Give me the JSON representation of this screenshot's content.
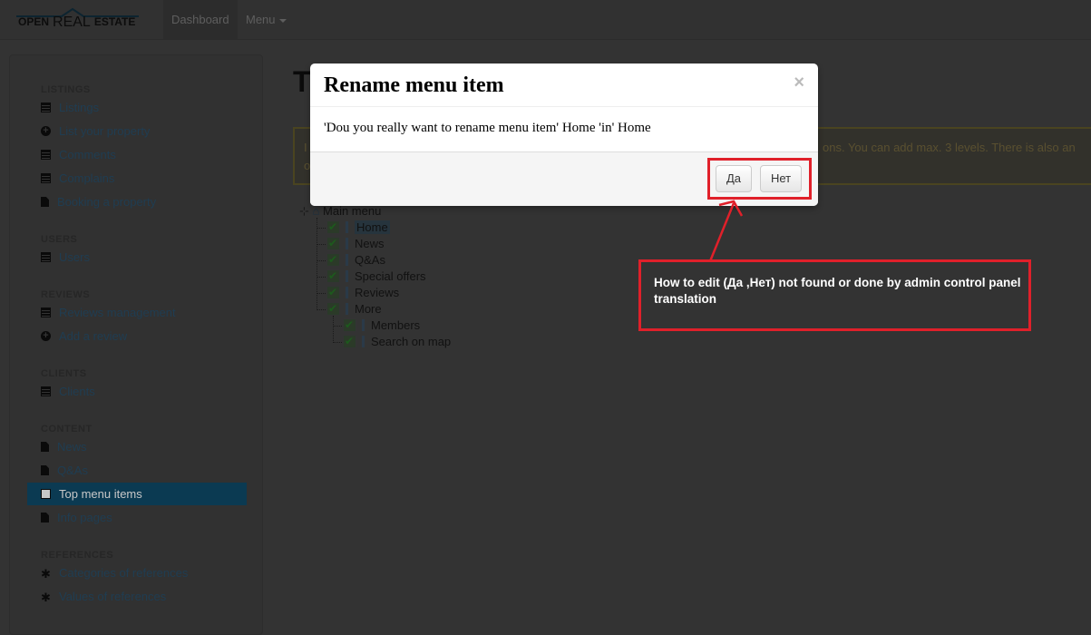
{
  "navbar": {
    "logo": {
      "open": "OPEN",
      "real": "REAL",
      "estate": "ESTATE"
    },
    "items": [
      {
        "label": "Dashboard",
        "active": true
      },
      {
        "label": "Menu",
        "dropdown": true
      }
    ]
  },
  "sidebar": {
    "sections": [
      {
        "title": "LISTINGS",
        "items": [
          {
            "label": "Listings",
            "icon": "list-icon"
          },
          {
            "label": "List your property",
            "icon": "plus-circle-icon"
          },
          {
            "label": "Comments",
            "icon": "list-icon"
          },
          {
            "label": "Complains",
            "icon": "list-icon"
          },
          {
            "label": "Booking a property",
            "icon": "file-icon"
          }
        ]
      },
      {
        "title": "USERS",
        "items": [
          {
            "label": "Users",
            "icon": "list-icon"
          }
        ]
      },
      {
        "title": "REVIEWS",
        "items": [
          {
            "label": "Reviews management",
            "icon": "list-icon"
          },
          {
            "label": "Add a review",
            "icon": "plus-circle-icon"
          }
        ]
      },
      {
        "title": "CLIENTS",
        "items": [
          {
            "label": "Clients",
            "icon": "list-icon"
          }
        ]
      },
      {
        "title": "CONTENT",
        "items": [
          {
            "label": "News",
            "icon": "file-icon"
          },
          {
            "label": "Q&As",
            "icon": "file-icon"
          },
          {
            "label": "Top menu items",
            "icon": "list-icon",
            "active": true
          },
          {
            "label": "Info pages",
            "icon": "file-icon"
          }
        ]
      },
      {
        "title": "REFERENCES",
        "items": [
          {
            "label": "Categories of references",
            "icon": "asterisk-icon"
          },
          {
            "label": "Values of references",
            "icon": "asterisk-icon"
          }
        ]
      }
    ]
  },
  "main": {
    "title_fragment": "T",
    "alert": {
      "line1_start": "I",
      "line1_end": "ons. You can add max. 3 levels. There is also an",
      "line2_start": "o"
    },
    "tree": {
      "root": "Main menu",
      "items": [
        "Home",
        "News",
        "Q&As",
        "Special offers",
        "Reviews",
        "More"
      ],
      "more_children": [
        "Members",
        "Search on map"
      ],
      "selected": "Home"
    }
  },
  "modal": {
    "title": "Rename menu item",
    "close": "×",
    "body": "'Dou you really want to rename menu item' Home 'in' Home",
    "yes": "Да",
    "no": "Нет"
  },
  "annotation": {
    "text": "How to edit (Да ,Нет) not found or done by admin control panel translation",
    "color": "#e0202a"
  }
}
